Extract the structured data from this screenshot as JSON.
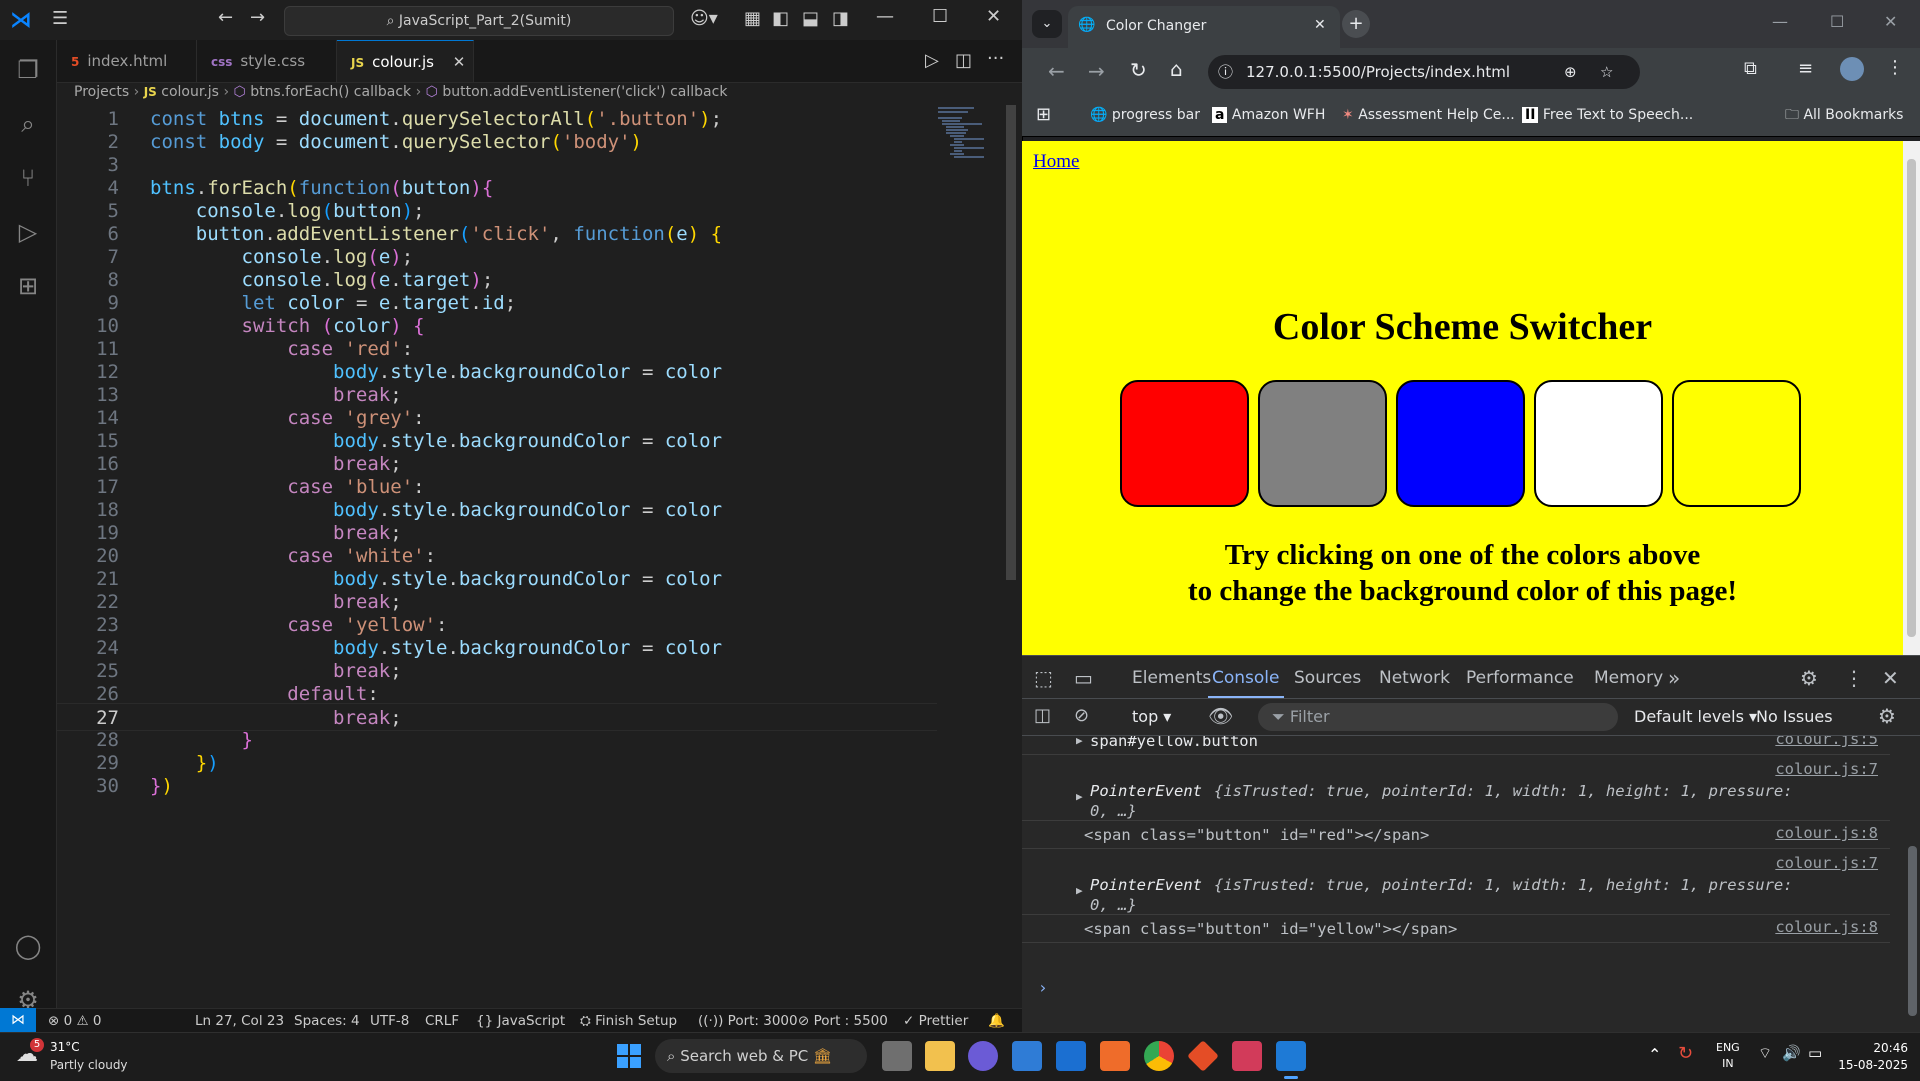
{
  "vscode": {
    "search_label": "JavaScript_Part_2(Sumit)",
    "tabs": [
      {
        "icon": "5",
        "label": "index.html"
      },
      {
        "icon": "css",
        "label": "style.css"
      },
      {
        "icon": "JS",
        "label": "colour.js",
        "close": "✕"
      }
    ],
    "breadcrumb": [
      "Projects",
      "JS",
      "colour.js",
      "btns.forEach() callback",
      "button.addEventListener('click') callback"
    ],
    "code_lines": [
      "1",
      "2",
      "3",
      "4",
      "5",
      "6",
      "7",
      "8",
      "9",
      "10",
      "11",
      "12",
      "13",
      "14",
      "15",
      "16",
      "17",
      "18",
      "19",
      "20",
      "21",
      "22",
      "23",
      "24",
      "25",
      "26",
      "27",
      "28",
      "29",
      "30"
    ],
    "status": {
      "errors": "0",
      "warnings": "0",
      "position": "Ln 27, Col 23",
      "spaces": "Spaces: 4",
      "encoding": "UTF-8",
      "eol": "CRLF",
      "language": "JavaScript",
      "finish_setup": "Finish Setup",
      "port1": "Port: 3000",
      "port2": "Port : 5500",
      "prettier": "Prettier"
    }
  },
  "browser": {
    "tab_title": "Color Changer",
    "url": "127.0.0.1:5500/Projects/index.html",
    "bookmarks": [
      "progress bar",
      "Amazon WFH",
      "Assessment Help Ce...",
      "Free Text to Speech...",
      "All Bookmarks"
    ],
    "page": {
      "home_link": "Home",
      "heading": "Color Scheme Switcher",
      "swatch_colors": [
        "#ff0000",
        "#808080",
        "#0000ff",
        "#ffffff",
        "#ffff00"
      ],
      "instruction_line1": "Try clicking on one of the colors above",
      "instruction_line2": "to change the background color of this page!"
    },
    "devtools": {
      "tabs": [
        "Elements",
        "Console",
        "Sources",
        "Network",
        "Performance",
        "Memory"
      ],
      "context": "top",
      "filter_placeholder": "Filter",
      "levels": "Default levels",
      "issues": "No Issues",
      "messages": [
        {
          "text": "span#yellow.button",
          "source": "colour.js:5"
        },
        {
          "text_a": "PointerEvent",
          "text_b": "{isTrusted: true, pointerId: 1, width: 1, height: 1, pressure:",
          "text_c": "0, …}",
          "source": "colour.js:7"
        },
        {
          "text": "<span class=\"button\" id=\"red\"></span>",
          "source": "colour.js:8"
        },
        {
          "text_a": "PointerEvent",
          "text_b": "{isTrusted: true, pointerId: 1, width: 1, height: 1, pressure:",
          "text_c": "0, …}",
          "source": "colour.js:7"
        },
        {
          "text": "<span class=\"button\" id=\"yellow\"></span>",
          "source": "colour.js:8"
        }
      ]
    }
  },
  "taskbar": {
    "weather_temp": "31°C",
    "weather_desc": "Partly cloudy",
    "weather_badge": "5",
    "search": "Search web & PC",
    "lang1": "ENG",
    "lang2": "IN",
    "time": "20:46",
    "date": "15-08-2025"
  }
}
